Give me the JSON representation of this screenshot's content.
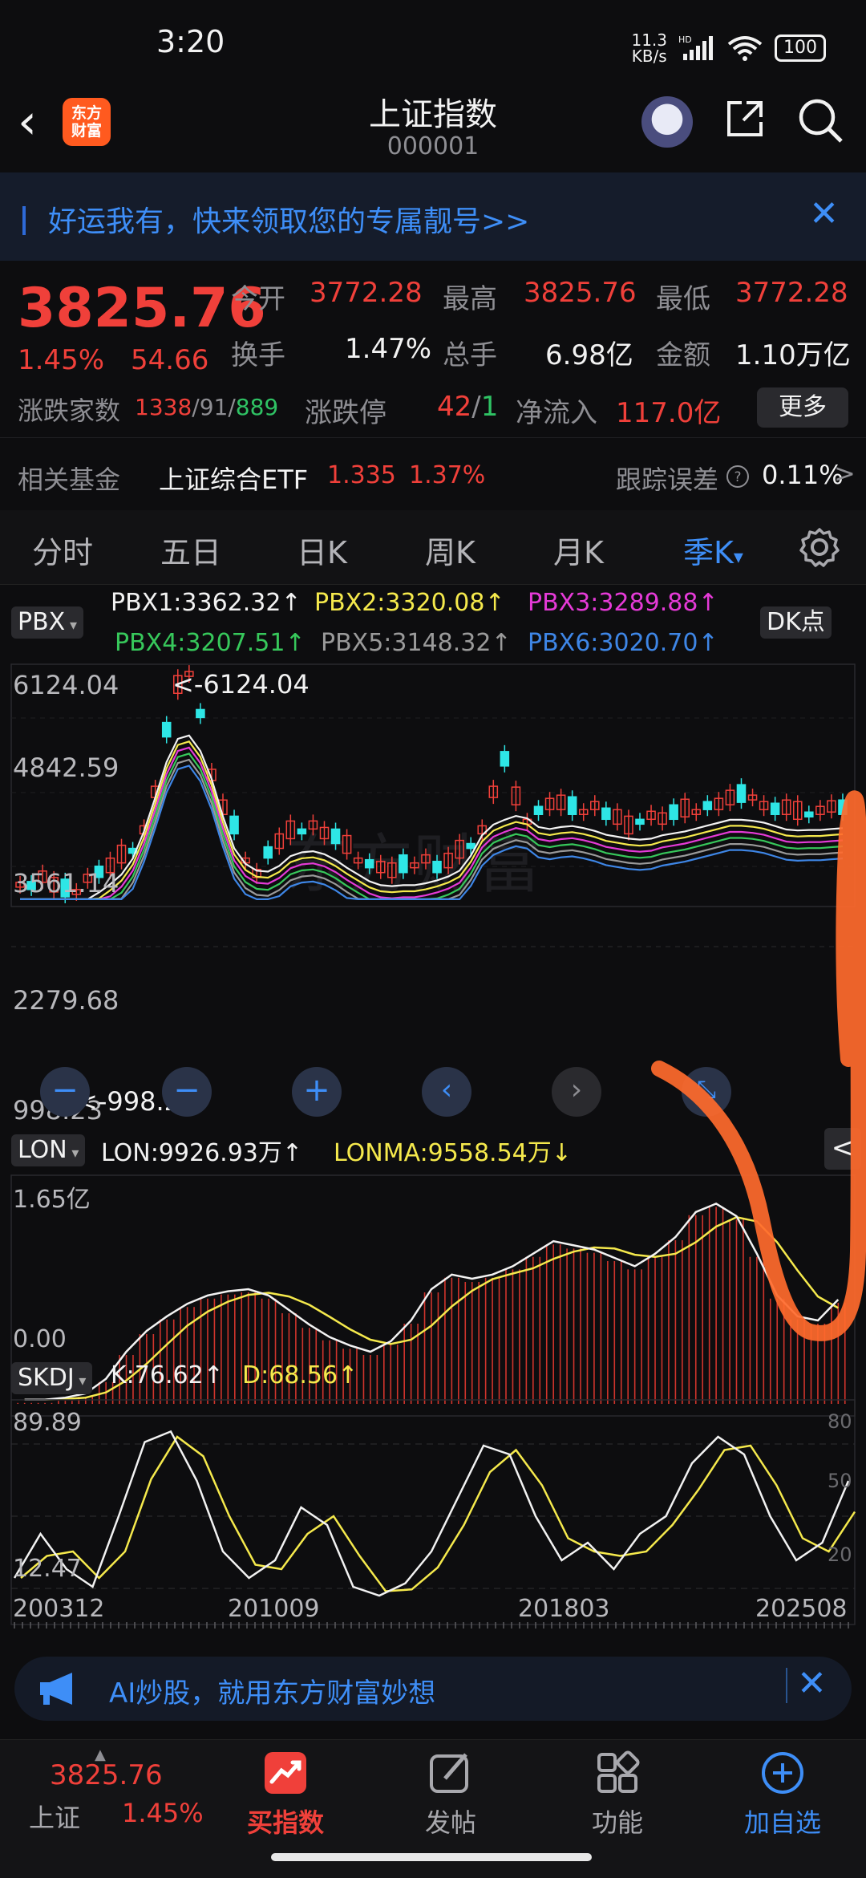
{
  "status": {
    "time": "3:20",
    "net_speed_top": "11.3",
    "net_speed_bottom": "KB/s",
    "hd": "HD",
    "battery": "100"
  },
  "header": {
    "logo_line1": "东方",
    "logo_line2": "财富",
    "title": "上证指数",
    "code": "000001"
  },
  "banner": {
    "text": "好运我有，快来领取您的专属靓号>>"
  },
  "quote": {
    "price": "3825.76",
    "change_pct": "1.45%",
    "change": "54.66",
    "open_label": "今开",
    "open": "3772.28",
    "high_label": "最高",
    "high": "3825.76",
    "low_label": "最低",
    "low": "3772.28",
    "turnover_label": "换手",
    "turnover": "1.47%",
    "volume_label": "总手",
    "volume": "6.98亿",
    "amount_label": "金额",
    "amount": "1.10万亿",
    "breadth_label": "涨跌家数",
    "up_count": "1338",
    "sep1": "/",
    "flat_count": "91",
    "sep2": "/",
    "down_count": "889",
    "limit_label": "涨跌停",
    "limit_up": "42",
    "sep3": "/",
    "limit_down": "1",
    "inflow_label": "净流入",
    "inflow": "117.0亿",
    "more": "更多"
  },
  "fund": {
    "label": "相关基金",
    "name": "上证综合ETF",
    "price": "1.335",
    "pct": "1.37%",
    "error_label": "跟踪误差",
    "error": "0.11%",
    "arrow": ">"
  },
  "tabs": [
    {
      "label": "分时"
    },
    {
      "label": "五日"
    },
    {
      "label": "日K"
    },
    {
      "label": "周K"
    },
    {
      "label": "月K"
    },
    {
      "label": "季K"
    }
  ],
  "tab_active_arrow": "▾",
  "main_chart": {
    "indicator": "PBX",
    "dk": "DK点",
    "pbx1": "PBX1:3362.32↑",
    "pbx2": "PBX2:3320.08↑",
    "pbx3": "PBX3:3289.88↑",
    "pbx4": "PBX4:3207.51↑",
    "pbx5": "PBX5:3148.32↑",
    "pbx6": "PBX6:3020.70↑",
    "y_labels": [
      "6124.04",
      "4842.59",
      "3561.14",
      "2279.68",
      "998.23"
    ],
    "max_note": "<-6124.04",
    "min_note": "<-998.23",
    "watermark": "东方财富",
    "colors": {
      "pbx1": "#f2f2f2",
      "pbx2": "#f5e94c",
      "pbx3": "#e53ad7",
      "pbx4": "#37c85b",
      "pbx5": "#9a9a9a",
      "pbx6": "#3e86e6"
    }
  },
  "lon_chart": {
    "indicator": "LON",
    "lon": "LON:9926.93万↑",
    "lonma": "LONMA:9558.54万↓",
    "y_top": "1.65亿",
    "y_bottom": "0.00",
    "collapse": "<"
  },
  "skdj_chart": {
    "indicator": "SKDJ",
    "k": "K:76.62↑",
    "d": "D:68.56↑",
    "y_top": "89.89",
    "y_bottom": "12.47",
    "r80": "80",
    "r50": "50",
    "r20": "20"
  },
  "x_axis": [
    "200312",
    "201009",
    "201803",
    "202508"
  ],
  "ad": {
    "text": "AI炒股，就用东方财富妙想"
  },
  "bottom_nav": {
    "index_price": "3825.76",
    "index_name": "上证",
    "index_pct": "1.45%",
    "buy": "买指数",
    "post": "发帖",
    "func": "功能",
    "add": "加自选"
  }
}
